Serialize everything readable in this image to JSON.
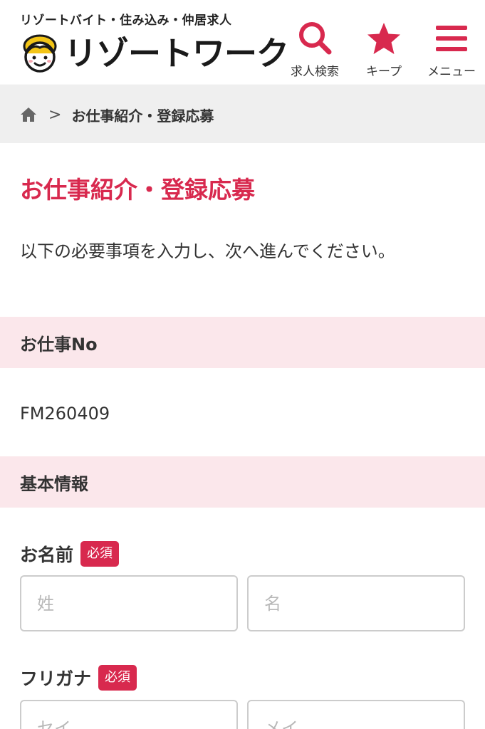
{
  "header": {
    "tagline": "リゾートバイト・住み込み・仲居求人",
    "logo_text": "リゾートワーク",
    "nav": {
      "search_label": "求人検索",
      "keep_label": "キープ",
      "menu_label": "メニュー"
    }
  },
  "breadcrumb": {
    "separator": ">",
    "current": "お仕事紹介・登録応募"
  },
  "main": {
    "title": "お仕事紹介・登録応募",
    "intro": "以下の必要事項を入力し、次へ進んでください。",
    "job_section": {
      "heading": "お仕事No",
      "job_number": "FM260409"
    },
    "basic_section": {
      "heading": "基本情報"
    },
    "name_field": {
      "label": "お名前",
      "required_badge": "必須",
      "last_placeholder": "姓",
      "first_placeholder": "名"
    },
    "kana_field": {
      "label": "フリガナ",
      "required_badge": "必須",
      "last_placeholder": "セイ",
      "first_placeholder": "メイ"
    }
  },
  "colors": {
    "accent": "#d8294e",
    "section_bg": "#fbe7eb",
    "breadcrumb_bg": "#efefef"
  },
  "icons": [
    "home-icon",
    "search-icon",
    "star-icon",
    "hamburger-menu-icon",
    "logo-face-icon"
  ]
}
